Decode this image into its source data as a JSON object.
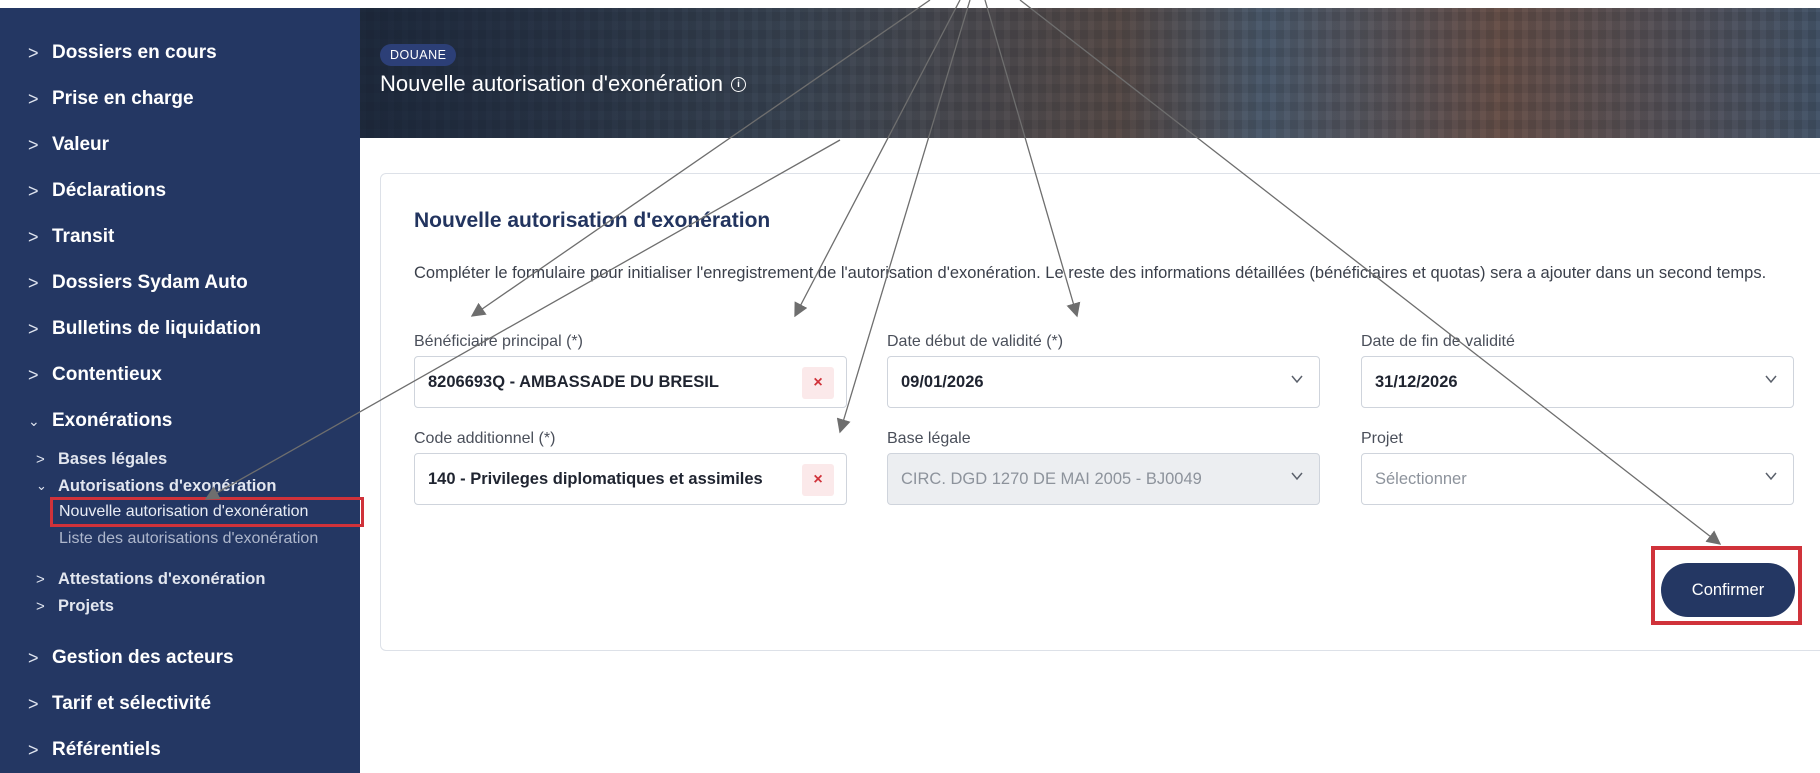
{
  "sidebar": {
    "items": [
      {
        "label": "Dossiers en cours",
        "expanded": false
      },
      {
        "label": "Prise en charge",
        "expanded": false
      },
      {
        "label": "Valeur",
        "expanded": false
      },
      {
        "label": "Déclarations",
        "expanded": false
      },
      {
        "label": "Transit",
        "expanded": false
      },
      {
        "label": "Dossiers Sydam Auto",
        "expanded": false
      },
      {
        "label": "Bulletins de liquidation",
        "expanded": false
      },
      {
        "label": "Contentieux",
        "expanded": false
      },
      {
        "label": "Exonérations",
        "expanded": true
      },
      {
        "label": "Gestion des acteurs",
        "expanded": false
      },
      {
        "label": "Tarif et sélectivité",
        "expanded": false
      },
      {
        "label": "Référentiels",
        "expanded": false
      }
    ],
    "sub": {
      "bases": "Bases légales",
      "autorisations": "Autorisations d'exonération",
      "nouvelle": "Nouvelle autorisation d'exonération",
      "liste": "Liste des autorisations d'exonération",
      "attestations": "Attestations d'exonération",
      "projets": "Projets"
    }
  },
  "header": {
    "badge": "DOUANE",
    "title": "Nouvelle autorisation d'exonération"
  },
  "form": {
    "title": "Nouvelle autorisation d'exonération",
    "description": "Compléter le formulaire pour initialiser l'enregistrement de l'autorisation d'exonération. Le reste des informations détaillées (bénéficiaires et quotas) sera a ajouter dans un second temps.",
    "beneficiaire": {
      "label": "Bénéficiaire principal (*)",
      "value": "8206693Q - AMBASSADE DU BRESIL"
    },
    "date_debut": {
      "label": "Date début de validité (*)",
      "value": "09/01/2026"
    },
    "date_fin": {
      "label": "Date de fin de validité",
      "value": "31/12/2026"
    },
    "code_add": {
      "label": "Code additionnel (*)",
      "value": "140 - Privileges diplomatiques et assimiles"
    },
    "base_legale": {
      "label": "Base légale",
      "value": "CIRC. DGD 1270 DE MAI 2005 - BJ0049"
    },
    "projet": {
      "label": "Projet",
      "placeholder": "Sélectionner"
    },
    "clear_glyph": "×",
    "confirm_label": "Confirmer"
  },
  "colors": {
    "sidebar_bg": "#243763",
    "accent": "#243763",
    "highlight": "#d0323a"
  }
}
